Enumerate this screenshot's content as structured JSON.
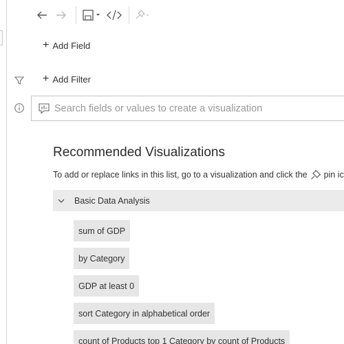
{
  "toolbar": {
    "back": "back-arrow-icon",
    "forward": "forward-arrow-icon",
    "save": "save-icon",
    "code": "code-icon",
    "pin": "pin-icon"
  },
  "add_field_label": "Add Field",
  "add_filter_label": "Add Filter",
  "search": {
    "placeholder": "Search fields or values to create a visualization"
  },
  "recommended": {
    "title": "Recommended Visualizations",
    "description_before": "To add or replace links in this list, go to a visualization and click the",
    "description_after": "pin icon"
  },
  "section": {
    "label": "Basic Data Analysis",
    "items": [
      "sum of GDP",
      "by Category",
      "GDP at least 0",
      "sort Category in alphabetical order",
      "count of Products top 1 Category by count of Products"
    ]
  },
  "colors": {
    "border": "#c4c4c4",
    "chip_bg": "#e6e6e6",
    "section_bg": "#ebebeb",
    "icon": "#555555",
    "icon_disabled": "#bbbbbb"
  }
}
